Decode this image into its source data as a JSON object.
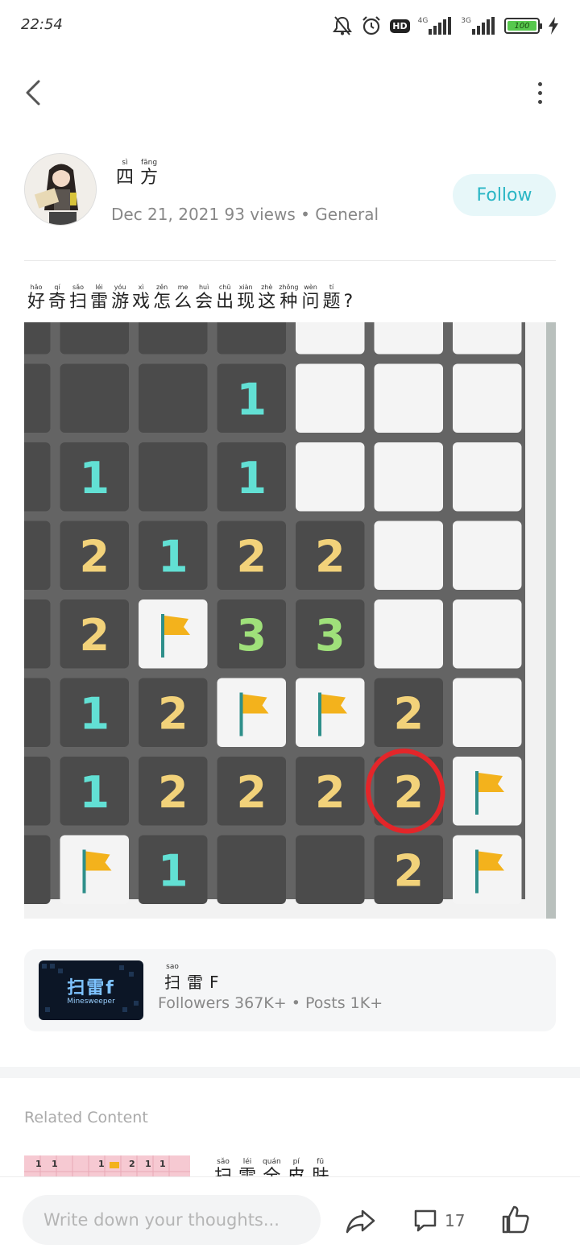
{
  "status_bar": {
    "time": "22:54",
    "hd": "HD",
    "net1": "4G",
    "net2": "3G",
    "battery": "100",
    "icons": [
      "mute-bell-icon",
      "alarm-icon",
      "hd-icon",
      "signal-icon",
      "signal-icon",
      "battery-icon",
      "charging-icon"
    ]
  },
  "header": {
    "back_icon": "chevron-left-icon",
    "more_icon": "more-vertical-icon"
  },
  "author": {
    "name": [
      {
        "py": "sì",
        "hz": "四"
      },
      {
        "py": "fāng",
        "hz": "方"
      }
    ],
    "meta": "Dec 21, 2021 93 views • General",
    "follow_label": "Follow"
  },
  "post": {
    "question": [
      {
        "py": "hǎo",
        "hz": "好"
      },
      {
        "py": "qí",
        "hz": "奇"
      },
      {
        "py": "sǎo",
        "hz": "扫"
      },
      {
        "py": "léi",
        "hz": "雷"
      },
      {
        "py": "yóu",
        "hz": "游"
      },
      {
        "py": "xì",
        "hz": "戏"
      },
      {
        "py": "zěn",
        "hz": "怎"
      },
      {
        "py": "me",
        "hz": "么"
      },
      {
        "py": "huì",
        "hz": "会"
      },
      {
        "py": "chū",
        "hz": "出"
      },
      {
        "py": "xiàn",
        "hz": "现"
      },
      {
        "py": "zhè",
        "hz": "这"
      },
      {
        "py": "zhǒng",
        "hz": "种"
      },
      {
        "py": "wèn",
        "hz": "问"
      },
      {
        "py": "tí",
        "hz": "题"
      },
      {
        "py": "",
        "hz": "?"
      }
    ],
    "board": [
      [
        "D",
        "D",
        "D",
        "D",
        "W",
        "W",
        "W"
      ],
      [
        "D",
        "D",
        "D",
        "1",
        "W",
        "W",
        "W"
      ],
      [
        "D",
        "1",
        "D",
        "1",
        "W",
        "W",
        "W"
      ],
      [
        "D",
        "2",
        "1",
        "2",
        "2",
        "W",
        "W"
      ],
      [
        "D",
        "2",
        "F",
        "3",
        "3",
        "W",
        "W"
      ],
      [
        "D",
        "1",
        "2",
        "F",
        "F",
        "2",
        "W"
      ],
      [
        "D",
        "1",
        "2",
        "2",
        "2",
        "2",
        "F"
      ],
      [
        "D",
        "F",
        "1",
        "D",
        "D",
        "2",
        "F"
      ]
    ],
    "circled_cell": [
      6,
      5
    ],
    "colors": {
      "one": "#62e0d4",
      "two": "#f2d27a",
      "three": "#9fe07a",
      "circle": "#e3262a",
      "flag": "#f3b21c"
    }
  },
  "circle": {
    "logo_main": "扫雷f",
    "logo_sub": "Minesweeper",
    "name": [
      {
        "py": "sao",
        "hz": "扫"
      },
      {
        "py": "",
        "hz": "雷"
      },
      {
        "py": "",
        "hz": "F"
      }
    ],
    "meta": "Followers 367K+ • Posts 1K+"
  },
  "related": {
    "title": "Related Content",
    "thumb_nums": [
      "1",
      "1",
      "1",
      "2",
      "1",
      "1"
    ],
    "item_text": [
      {
        "py": "sǎo",
        "hz": "扫"
      },
      {
        "py": "léi",
        "hz": "雷"
      },
      {
        "py": "quán",
        "hz": "全"
      },
      {
        "py": "pí",
        "hz": "皮"
      },
      {
        "py": "fū",
        "hz": "肤"
      }
    ]
  },
  "bottom_bar": {
    "placeholder": "Write down your thoughts...",
    "comment_count": "17",
    "share_icon": "share-arrow-icon",
    "comment_icon": "comment-bubble-icon",
    "like_icon": "thumbs-up-icon"
  }
}
